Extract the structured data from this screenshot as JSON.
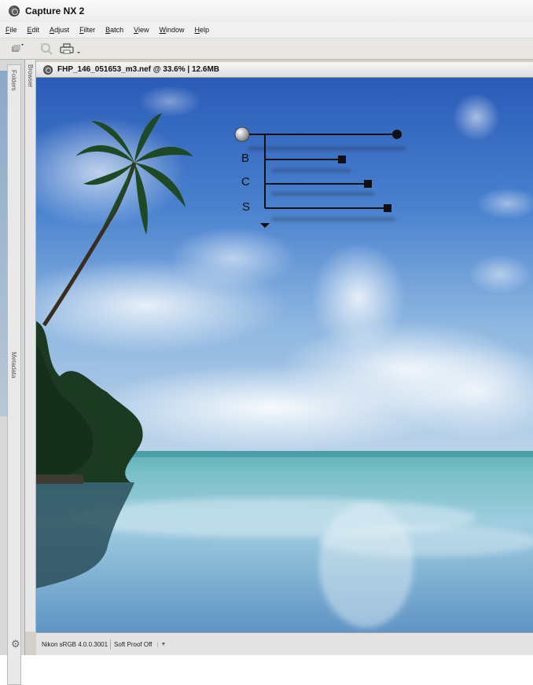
{
  "app": {
    "title": "Capture NX 2"
  },
  "menu": {
    "items": [
      "File",
      "Edit",
      "Adjust",
      "Filter",
      "Batch",
      "View",
      "Window",
      "Help"
    ]
  },
  "toolbar": {
    "icons": [
      "browser-icon",
      "magnifier-icon",
      "print-icon",
      "dropdown-icon"
    ]
  },
  "panels": {
    "folders": "Folders",
    "browser": "Browser",
    "metadata": "Metadata"
  },
  "document": {
    "title": "FHP_146_051653_m3.nef @ 33.6% | 12.6MB"
  },
  "overlay": {
    "labels": [
      "B",
      "C",
      "S"
    ]
  },
  "status": {
    "profile": "Nikon sRGB 4.0.0.3001",
    "soft_proof": "Soft Proof Off"
  },
  "colors": {
    "sky_top": "#2b5db8",
    "sky_mid": "#6ea0d6",
    "sea": "#5aa8b5"
  }
}
